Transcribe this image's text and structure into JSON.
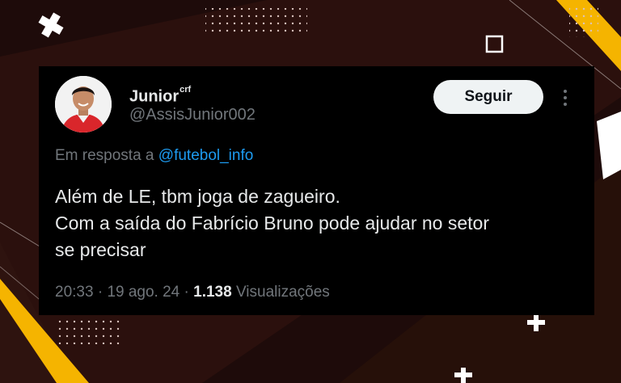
{
  "tweet": {
    "author": {
      "name": "Junior",
      "badge": "crf",
      "handle": "@AssisJunior002"
    },
    "follow_label": "Seguir",
    "reply_prefix": "Em resposta a",
    "reply_mention": "@futebol_info",
    "text_lines": [
      "Além de LE, tbm joga de zagueiro.",
      "Com a saída do Fabrício Bruno pode ajudar no setor",
      "se precisar"
    ],
    "time": "20:33",
    "separator": "·",
    "date": "19 ago. 24",
    "views_count": "1.138",
    "views_label": "Visualizações"
  },
  "colors": {
    "background": "#1e0b0a",
    "card": "#000000",
    "accent_yellow": "#f5b400",
    "link_blue": "#1d9bf0",
    "muted_text": "#71767b",
    "primary_text": "#e7e9ea"
  },
  "icons": [
    "avatar-photo",
    "more-options-icon",
    "plus-decoration",
    "square-decoration"
  ]
}
